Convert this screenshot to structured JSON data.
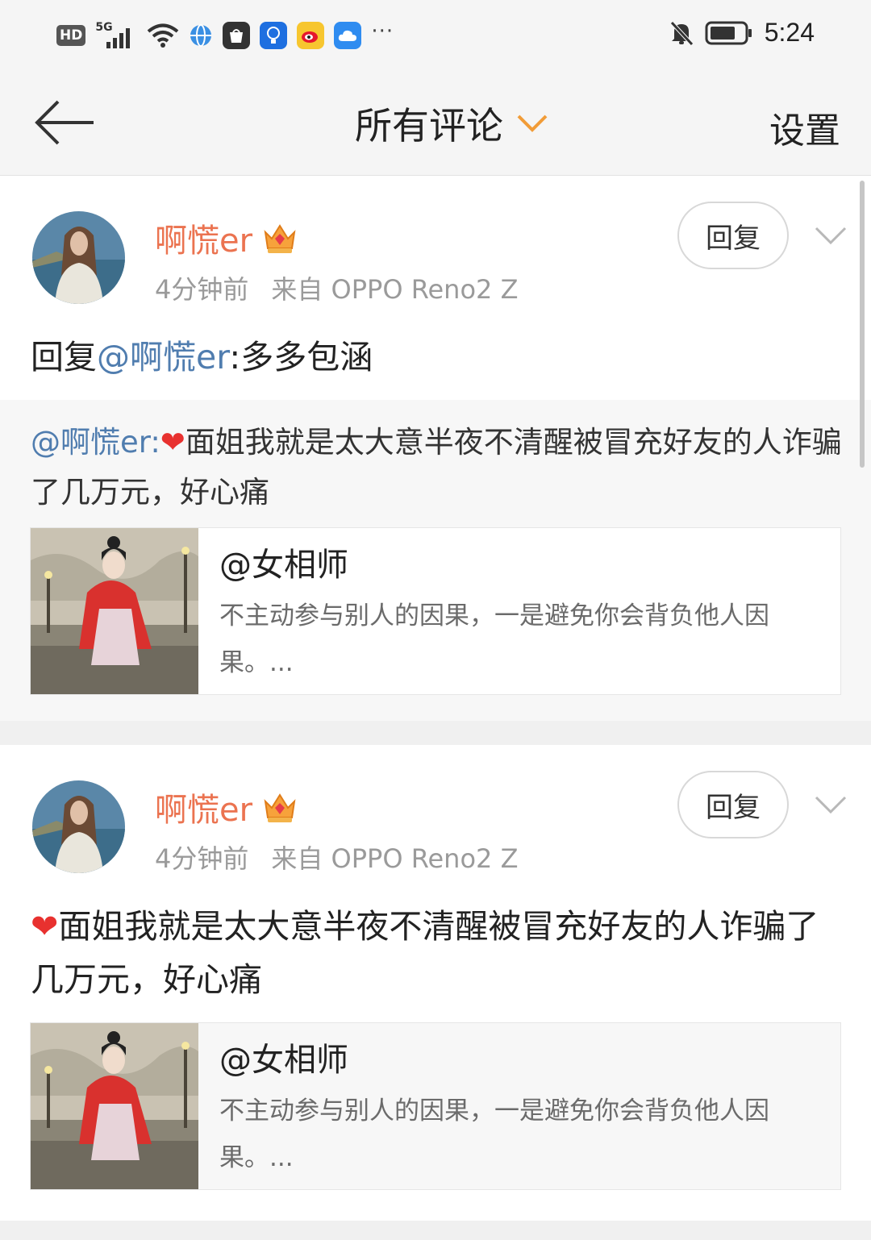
{
  "status_bar": {
    "hd": "HD",
    "network": "5G",
    "time": "5:24",
    "more": "···",
    "icons": [
      "signal-icon",
      "wifi-icon",
      "browser-icon",
      "bag-icon",
      "bulb-app-icon",
      "weibo-icon",
      "cloud-icon",
      "bell-muted-icon",
      "battery-icon"
    ]
  },
  "nav": {
    "title": "所有评论",
    "settings": "设置"
  },
  "comments": [
    {
      "username": "啊慌er",
      "time": "4分钟前",
      "source": "来自 OPPO Reno2 Z",
      "reply_label": "回复",
      "text_prefix": "回复",
      "text_mention": "@啊慌er",
      "text_body": ":多多包涵",
      "quote_mention": "@啊慌er:",
      "quote_heart": "❤",
      "quote_body": "面姐我就是太大意半夜不清醒被冒充好友的人诈骗了几万元，好心痛",
      "share_title": "@女相师",
      "share_desc": "不主动参与别人的因果，一是避免你会背负他人因果。..."
    },
    {
      "username": "啊慌er",
      "time": "4分钟前",
      "source": "来自 OPPO Reno2 Z",
      "reply_label": "回复",
      "text_heart": "❤",
      "text_body": "面姐我就是太大意半夜不清醒被冒充好友的人诈骗了几万元，好心痛",
      "share_title": "@女相师",
      "share_desc": "不主动参与别人的因果，一是避免你会背负他人因果。..."
    }
  ],
  "colors": {
    "username": "#eb7350",
    "mention": "#507daf",
    "heart": "#e8312f"
  }
}
